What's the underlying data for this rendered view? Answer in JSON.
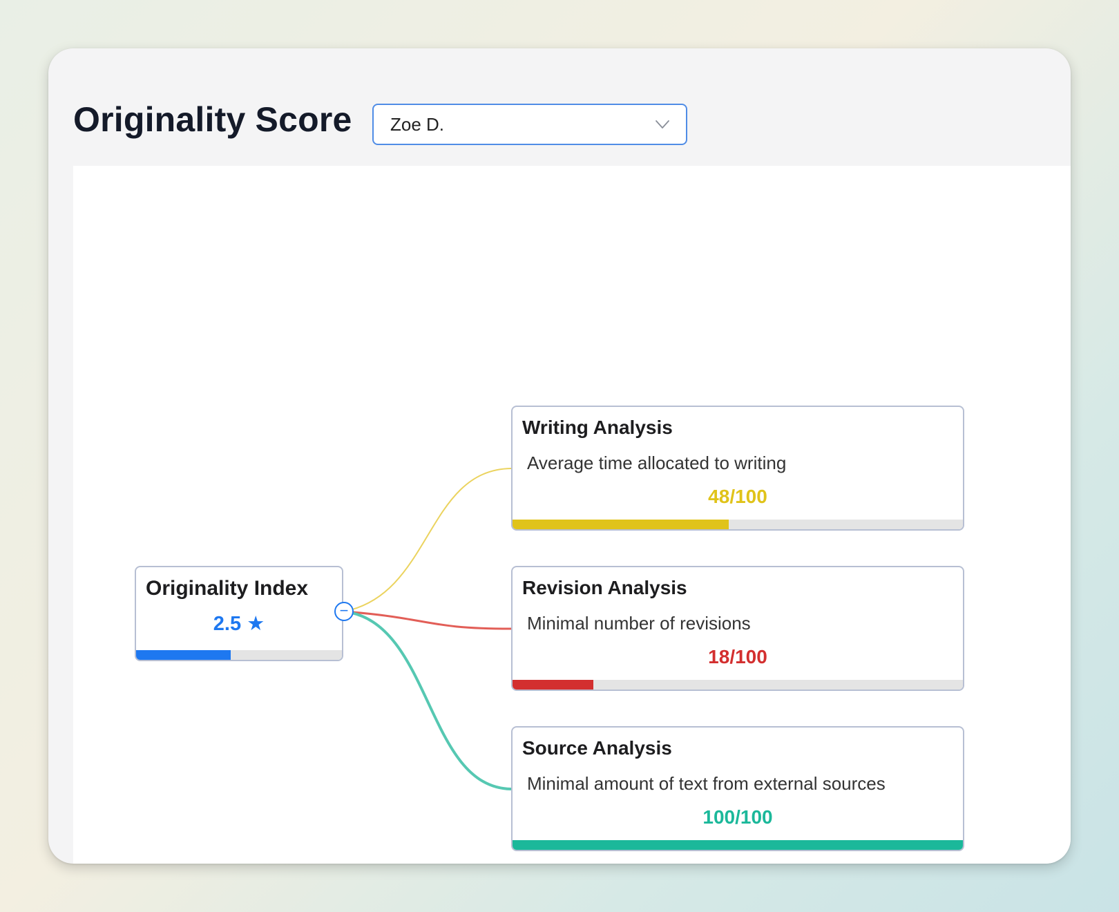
{
  "header": {
    "title": "Originality Score",
    "student_select": {
      "selected": "Zoe D."
    }
  },
  "root": {
    "title": "Originality Index",
    "value": "2.5",
    "star_icon": "star-icon",
    "progress": 0.46,
    "color": "#1e78f0"
  },
  "children": [
    {
      "title": "Writing Analysis",
      "description": "Average time allocated to writing",
      "score_text": "48/100",
      "score": 48,
      "color": "#e0c31a"
    },
    {
      "title": "Revision Analysis",
      "description": "Minimal number of revisions",
      "score_text": "18/100",
      "score": 18,
      "color": "#d32f2f"
    },
    {
      "title": "Source Analysis",
      "description": "Minimal amount of text from external sources",
      "score_text": "100/100",
      "score": 100,
      "color": "#1bb89a"
    }
  ],
  "connector_colors": [
    "#ebd35e",
    "#e25e57",
    "#56c8b2"
  ],
  "icons": {
    "chevron": "chevron-down-icon",
    "collapse": "minus-circle-icon"
  }
}
